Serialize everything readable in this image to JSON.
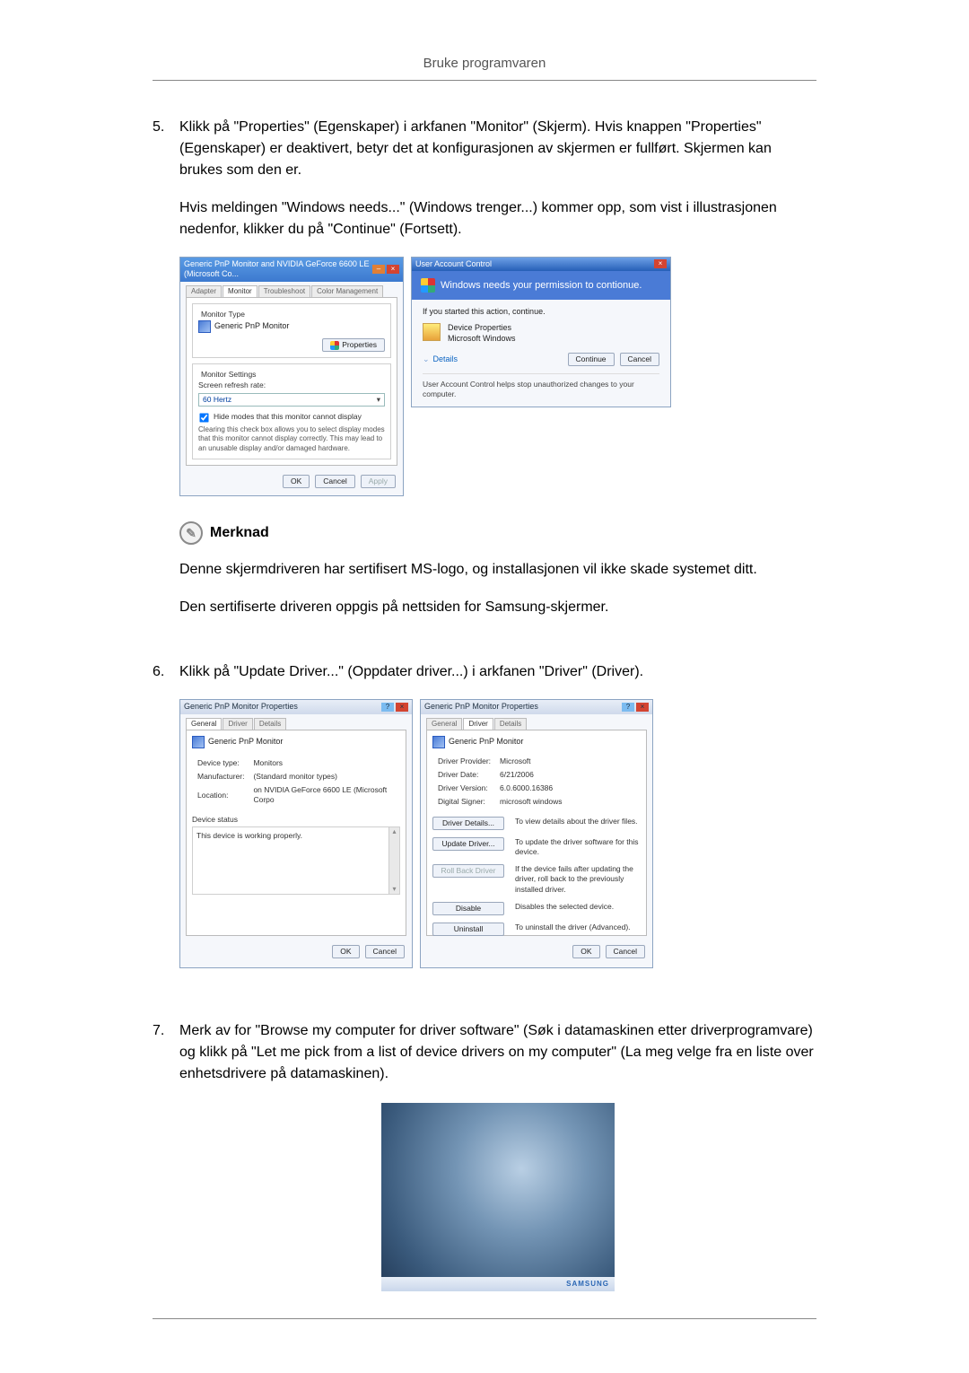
{
  "page": {
    "header": "Bruke programvaren"
  },
  "step5": {
    "num": "5.",
    "para1": "Klikk på \"Properties\" (Egenskaper) i arkfanen \"Monitor\" (Skjerm). Hvis knappen \"Properties\" (Egenskaper) er deaktivert, betyr det at konfigurasjonen av skjermen er fullført. Skjermen kan brukes som den er.",
    "para2": "Hvis meldingen \"Windows needs...\" (Windows trenger...) kommer opp, som vist i illustrasjonen nedenfor, klikker du på \"Continue\" (Fortsett)."
  },
  "dlg_monitor": {
    "title": "Generic PnP Monitor and NVIDIA GeForce 6600 LE (Microsoft Co...",
    "tabs": {
      "adapter": "Adapter",
      "monitor": "Monitor",
      "troubleshoot": "Troubleshoot",
      "color": "Color Management"
    },
    "section_monitor_type": "Monitor Type",
    "monitor_name": "Generic PnP Monitor",
    "properties_btn": "Properties",
    "section_monitor_settings": "Monitor Settings",
    "refresh_label": "Screen refresh rate:",
    "refresh_value": "60 Hertz",
    "hide_modes": "Hide modes that this monitor cannot display",
    "hide_modes_note": "Clearing this check box allows you to select display modes that this monitor cannot display correctly. This may lead to an unusable display and/or damaged hardware.",
    "ok": "OK",
    "cancel": "Cancel",
    "apply": "Apply"
  },
  "dlg_uac": {
    "title": "User Account Control",
    "headline": "Windows needs your permission to contionue.",
    "if_started": "If you started this action, continue.",
    "item_title": "Device Properties",
    "item_sub": "Microsoft Windows",
    "details": "Details",
    "continue": "Continue",
    "cancel": "Cancel",
    "footer": "User Account Control helps stop unauthorized changes to your computer."
  },
  "note": {
    "label": "Merknad",
    "p1": "Denne skjermdriveren har sertifisert MS-logo, og installasjonen vil ikke skade systemet ditt.",
    "p2": "Den sertifiserte driveren oppgis på nettsiden for Samsung-skjermer."
  },
  "step6": {
    "num": "6.",
    "para": "Klikk på \"Update Driver...\" (Oppdater driver...) i arkfanen \"Driver\" (Driver)."
  },
  "dlg_general": {
    "title": "Generic PnP Monitor Properties",
    "tabs": {
      "general": "General",
      "driver": "Driver",
      "details": "Details"
    },
    "device_name": "Generic PnP Monitor",
    "rows": {
      "devtype_l": "Device type:",
      "devtype_v": "Monitors",
      "manu_l": "Manufacturer:",
      "manu_v": "(Standard monitor types)",
      "loc_l": "Location:",
      "loc_v": "on NVIDIA GeForce 6600 LE (Microsoft Corpo"
    },
    "status_label": "Device status",
    "status_text": "This device is working properly.",
    "ok": "OK",
    "cancel": "Cancel"
  },
  "dlg_driver": {
    "title": "Generic PnP Monitor Properties",
    "tabs": {
      "general": "General",
      "driver": "Driver",
      "details": "Details"
    },
    "device_name": "Generic PnP Monitor",
    "rows": {
      "prov_l": "Driver Provider:",
      "prov_v": "Microsoft",
      "date_l": "Driver Date:",
      "date_v": "6/21/2006",
      "ver_l": "Driver Version:",
      "ver_v": "6.0.6000.16386",
      "sign_l": "Digital Signer:",
      "sign_v": "microsoft windows"
    },
    "btns": {
      "details": "Driver Details...",
      "details_d": "To view details about the driver files.",
      "update": "Update Driver...",
      "update_d": "To update the driver software for this device.",
      "rollback": "Roll Back Driver",
      "rollback_d": "If the device fails after updating the driver, roll back to the previously installed driver.",
      "disable": "Disable",
      "disable_d": "Disables the selected device.",
      "uninstall": "Uninstall",
      "uninstall_d": "To uninstall the driver (Advanced)."
    },
    "ok": "OK",
    "cancel": "Cancel"
  },
  "step7": {
    "num": "7.",
    "para": "Merk av for \"Browse my computer for driver software\" (Søk i datamaskinen etter driverprogramvare) og klikk på \"Let me pick from a list of device drivers on my computer\" (La meg velge fra en liste over enhetsdrivere på datamaskinen)."
  },
  "desktop": {
    "taskbar_brand": "SAMSUNG"
  }
}
